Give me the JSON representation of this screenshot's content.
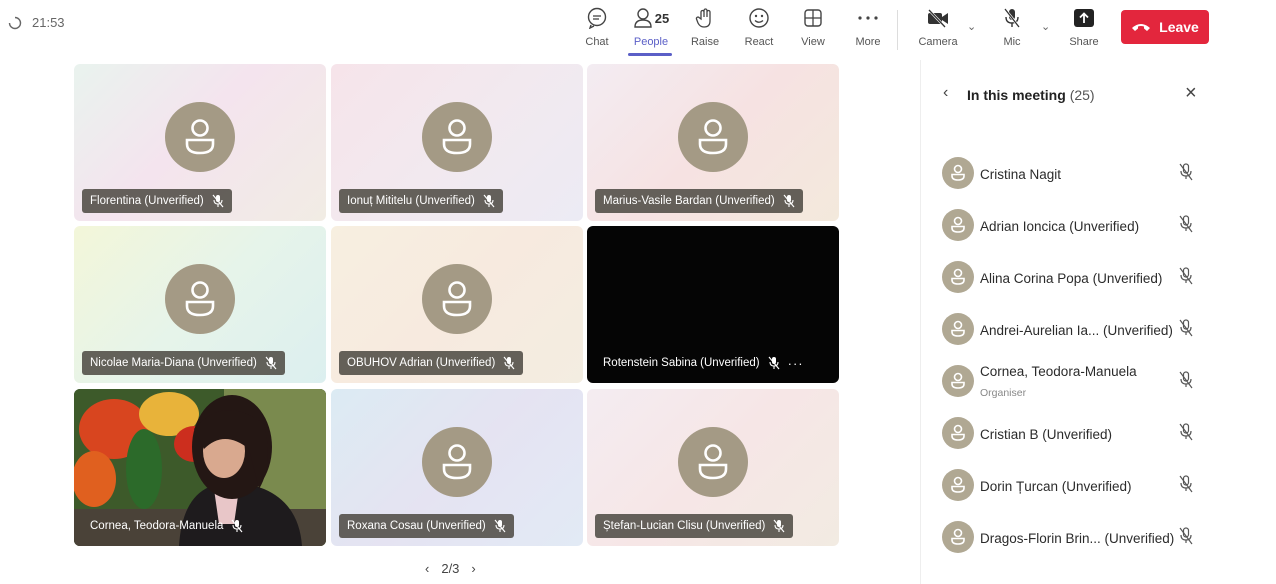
{
  "topbar": {
    "time": "21:53",
    "chat_label": "Chat",
    "people_label": "People",
    "people_count": "25",
    "raise_label": "Raise",
    "react_label": "React",
    "view_label": "View",
    "more_label": "More",
    "camera_label": "Camera",
    "mic_label": "Mic",
    "share_label": "Share",
    "leave_label": "Leave"
  },
  "tiles": [
    {
      "name": "Florentina (Unverified)"
    },
    {
      "name": "Ionuț Mititelu (Unverified)"
    },
    {
      "name": "Marius-Vasile Bardan (Unverified)"
    },
    {
      "name": "Nicolae Maria-Diana (Unverified)"
    },
    {
      "name": "OBUHOV Adrian (Unverified)"
    },
    {
      "name": "Rotenstein Sabina (Unverified)"
    },
    {
      "name": "Cornea, Teodora-Manuela"
    },
    {
      "name": "Roxana Cosau (Unverified)"
    },
    {
      "name": "Ștefan-Lucian Clisu (Unverified)"
    }
  ],
  "pager": {
    "text": "2/3"
  },
  "panel": {
    "title": "In this meeting",
    "count": "(25)",
    "participants": [
      {
        "name": "Cristina Nagit",
        "role": ""
      },
      {
        "name": "Adrian Ioncica (Unverified)",
        "role": ""
      },
      {
        "name": "Alina Corina Popa (Unverified)",
        "role": ""
      },
      {
        "name": "Andrei-Aurelian Ia... (Unverified)",
        "role": ""
      },
      {
        "name": "Cornea, Teodora-Manuela",
        "role": "Organiser"
      },
      {
        "name": "Cristian B (Unverified)",
        "role": ""
      },
      {
        "name": "Dorin Țurcan (Unverified)",
        "role": ""
      },
      {
        "name": "Dragos-Florin Brin... (Unverified)",
        "role": ""
      }
    ]
  },
  "colors": {
    "accent": "#5b5fc7",
    "leave": "#e3263d",
    "avatar": "#a49a85"
  }
}
